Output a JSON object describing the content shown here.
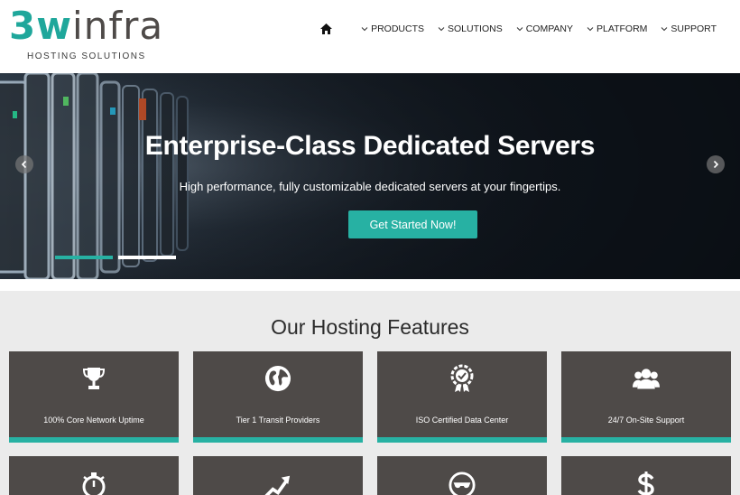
{
  "brand": {
    "logo_teal": "3w",
    "logo_gray": "infra",
    "tagline": "HOSTING SOLUTIONS"
  },
  "nav": {
    "home_icon": "home-icon",
    "items": [
      {
        "label": "PRODUCTS"
      },
      {
        "label": "SOLUTIONS"
      },
      {
        "label": "COMPANY"
      },
      {
        "label": "PLATFORM"
      },
      {
        "label": "SUPPORT"
      }
    ]
  },
  "hero": {
    "title": "Enterprise-Class Dedicated Servers",
    "subtitle": "High performance, fully customizable dedicated servers at your fingertips.",
    "cta_label": "Get Started Now!",
    "slides_total": 2,
    "active_slide": 1
  },
  "features": {
    "title": "Our Hosting Features",
    "cards": [
      {
        "label": "100% Core Network Uptime",
        "icon": "trophy-icon"
      },
      {
        "label": "Tier 1 Transit Providers",
        "icon": "globe-icon"
      },
      {
        "label": "ISO Certified Data Center",
        "icon": "certified-badge-icon"
      },
      {
        "label": "24/7 On-Site Support",
        "icon": "users-icon"
      },
      {
        "label": "",
        "icon": "stopwatch-icon"
      },
      {
        "label": "",
        "icon": "growth-arrow-icon"
      },
      {
        "label": "",
        "icon": "sunglasses-face-icon"
      },
      {
        "label": "",
        "icon": "dollar-icon"
      }
    ]
  },
  "colors": {
    "accent": "#27b1a3",
    "card_bg": "#4e4a48",
    "section_bg": "#ebebeb"
  }
}
